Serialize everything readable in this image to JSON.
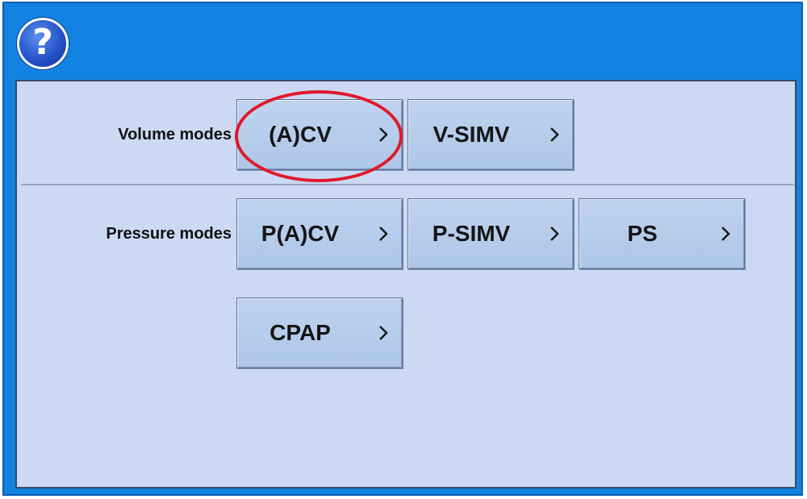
{
  "header": {
    "help_glyph": "?",
    "help_icon": "question-mark-icon",
    "frame_color": "#1283e3",
    "panel_color": "#ccd9f2"
  },
  "volume_modes": {
    "label": "Volume modes",
    "buttons": [
      {
        "label": "(A)CV",
        "highlighted": true
      },
      {
        "label": "V-SIMV",
        "highlighted": false
      }
    ]
  },
  "pressure_modes": {
    "label": "Pressure modes",
    "buttons": [
      {
        "label": "P(A)CV"
      },
      {
        "label": "P-SIMV"
      },
      {
        "label": "PS"
      },
      {
        "label": "CPAP"
      }
    ]
  },
  "annotation": {
    "highlight_color": "#e0182a",
    "highlighted_item": "(A)CV"
  }
}
